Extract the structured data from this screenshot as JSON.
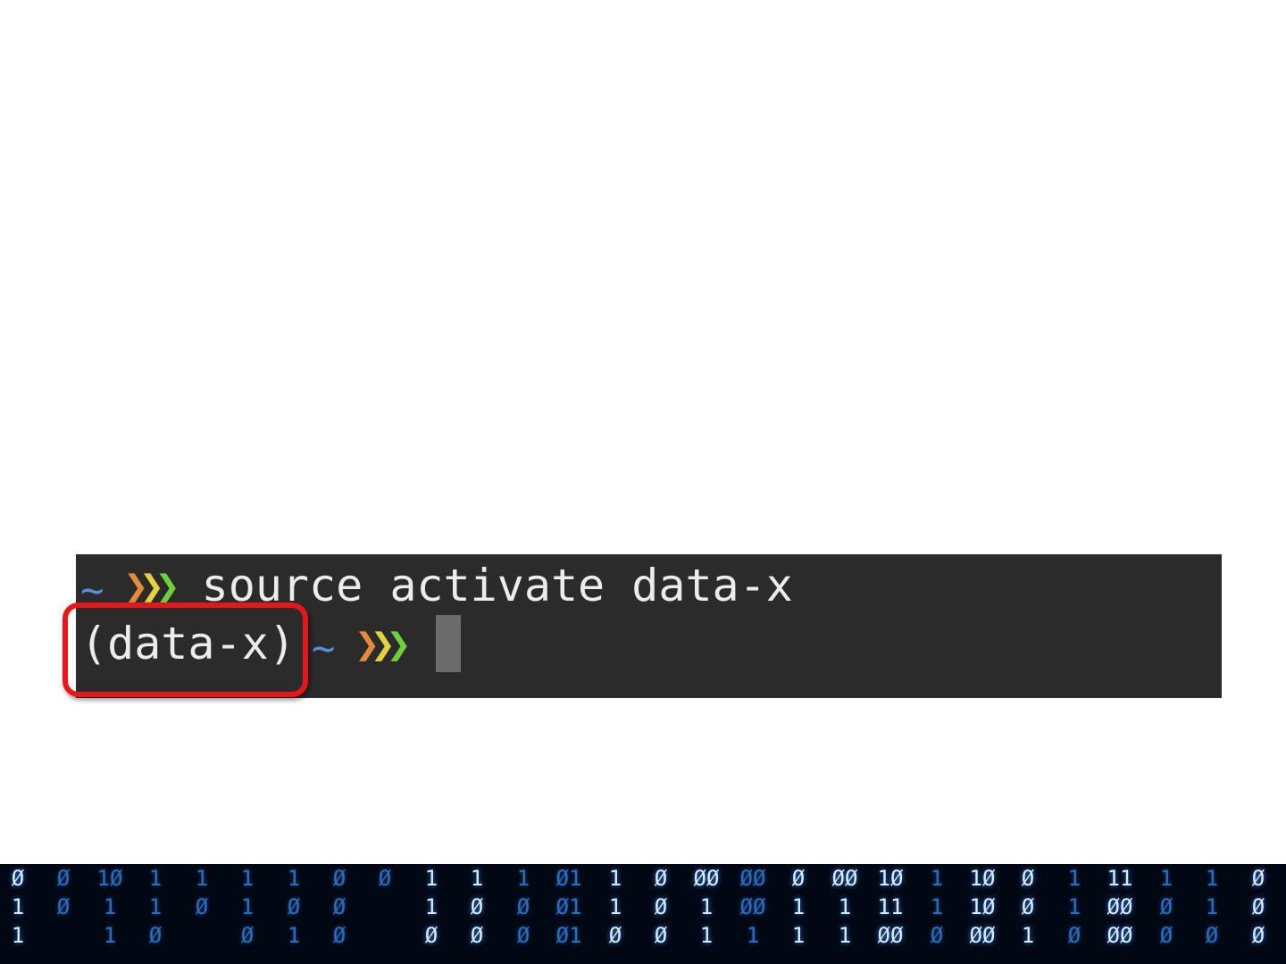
{
  "terminal": {
    "line1": {
      "prompt_tilde": "~",
      "prompt_chevrons": [
        "❯",
        "❯",
        "❯"
      ],
      "command": "source activate data-x"
    },
    "line2": {
      "env_name": "(data-x)",
      "prompt_tilde": "~",
      "prompt_chevrons": [
        "❯",
        "❯",
        "❯"
      ]
    }
  },
  "colors": {
    "terminal_bg": "#2b2b2b",
    "text": "#ececec",
    "tilde": "#5b8fd6",
    "chevron_orange": "#e58a3c",
    "chevron_yellow": "#e3d23c",
    "chevron_green": "#6fcf3c",
    "highlight": "#e8151b",
    "cursor": "#6c6c6c"
  },
  "decoration": {
    "matrix_columns": [
      {
        "chars": [
          "Ø",
          "1",
          "1"
        ],
        "tone": "bright"
      },
      {
        "chars": [
          "Ø",
          "Ø",
          ""
        ],
        "tone": "dim"
      },
      {
        "chars": [
          "1Ø",
          "1",
          "1"
        ],
        "tone": "dim"
      },
      {
        "chars": [
          "1",
          "1",
          "Ø"
        ],
        "tone": "dim"
      },
      {
        "chars": [
          "",
          "1",
          "Ø"
        ],
        "tone": "dim"
      },
      {
        "chars": [
          "1",
          "1",
          "Ø"
        ],
        "tone": "dim"
      },
      {
        "chars": [
          "1",
          "Ø",
          "1"
        ],
        "tone": "dim"
      },
      {
        "chars": [
          "Ø",
          "Ø",
          "Ø"
        ],
        "tone": "dim"
      },
      {
        "chars": [
          "",
          "",
          "Ø"
        ],
        "tone": "dim"
      },
      {
        "chars": [
          "1",
          "1",
          "Ø"
        ],
        "tone": "bright"
      },
      {
        "chars": [
          "1",
          "Ø",
          "Ø"
        ],
        "tone": "bright"
      },
      {
        "chars": [
          "1",
          "Ø",
          "Ø"
        ],
        "tone": "dim"
      },
      {
        "chars": [
          "Ø1",
          "Ø1",
          "Ø1"
        ],
        "tone": "dim"
      },
      {
        "chars": [
          "1",
          "1",
          "Ø"
        ],
        "tone": "bright"
      },
      {
        "chars": [
          "Ø",
          "Ø",
          "Ø"
        ],
        "tone": "bright"
      },
      {
        "chars": [
          "ØØ",
          "1",
          "1"
        ],
        "tone": "bright"
      },
      {
        "chars": [
          "ØØ",
          "ØØ",
          "1"
        ],
        "tone": "dim"
      },
      {
        "chars": [
          "Ø",
          "1",
          "1"
        ],
        "tone": "bright"
      },
      {
        "chars": [
          "ØØ",
          "1",
          "1"
        ],
        "tone": "bright"
      },
      {
        "chars": [
          "1Ø",
          "11",
          "ØØ"
        ],
        "tone": "bright"
      },
      {
        "chars": [
          "1",
          "1",
          "Ø"
        ],
        "tone": "dim"
      },
      {
        "chars": [
          "1Ø",
          "1Ø",
          "ØØ"
        ],
        "tone": "bright"
      },
      {
        "chars": [
          "Ø",
          "Ø",
          "1"
        ],
        "tone": "bright"
      },
      {
        "chars": [
          "1",
          "1",
          "Ø"
        ],
        "tone": "dim"
      },
      {
        "chars": [
          "11",
          "ØØ",
          "ØØ"
        ],
        "tone": "bright"
      },
      {
        "chars": [
          "1",
          "Ø",
          "Ø"
        ],
        "tone": "dim"
      },
      {
        "chars": [
          "1",
          "1",
          "Ø"
        ],
        "tone": "dim"
      },
      {
        "chars": [
          "Ø",
          "Ø",
          "Ø"
        ],
        "tone": "bright"
      }
    ]
  }
}
